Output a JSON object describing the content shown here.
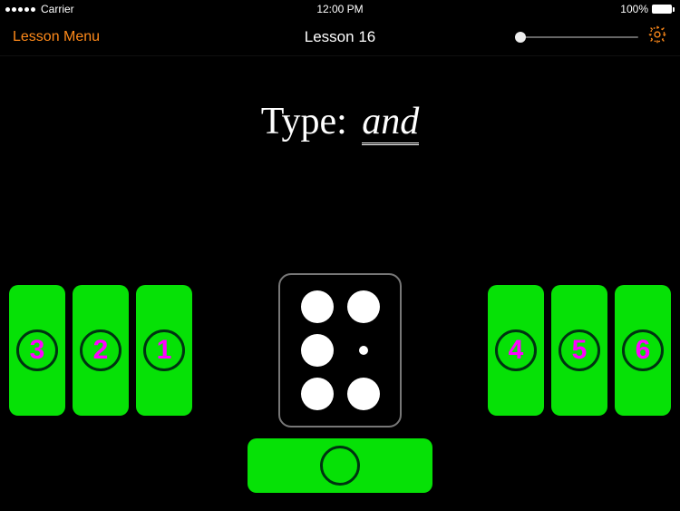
{
  "status": {
    "carrier": "Carrier",
    "time": "12:00 PM",
    "battery_pct": "100%"
  },
  "nav": {
    "back_label": "Lesson Menu",
    "title": "Lesson 16"
  },
  "prompt": {
    "prefix": "Type:",
    "word": "and"
  },
  "keys": {
    "left": [
      "3",
      "2",
      "1"
    ],
    "right": [
      "4",
      "5",
      "6"
    ]
  },
  "braille": {
    "dots_filled": [
      true,
      true,
      true,
      false,
      true,
      true
    ]
  }
}
